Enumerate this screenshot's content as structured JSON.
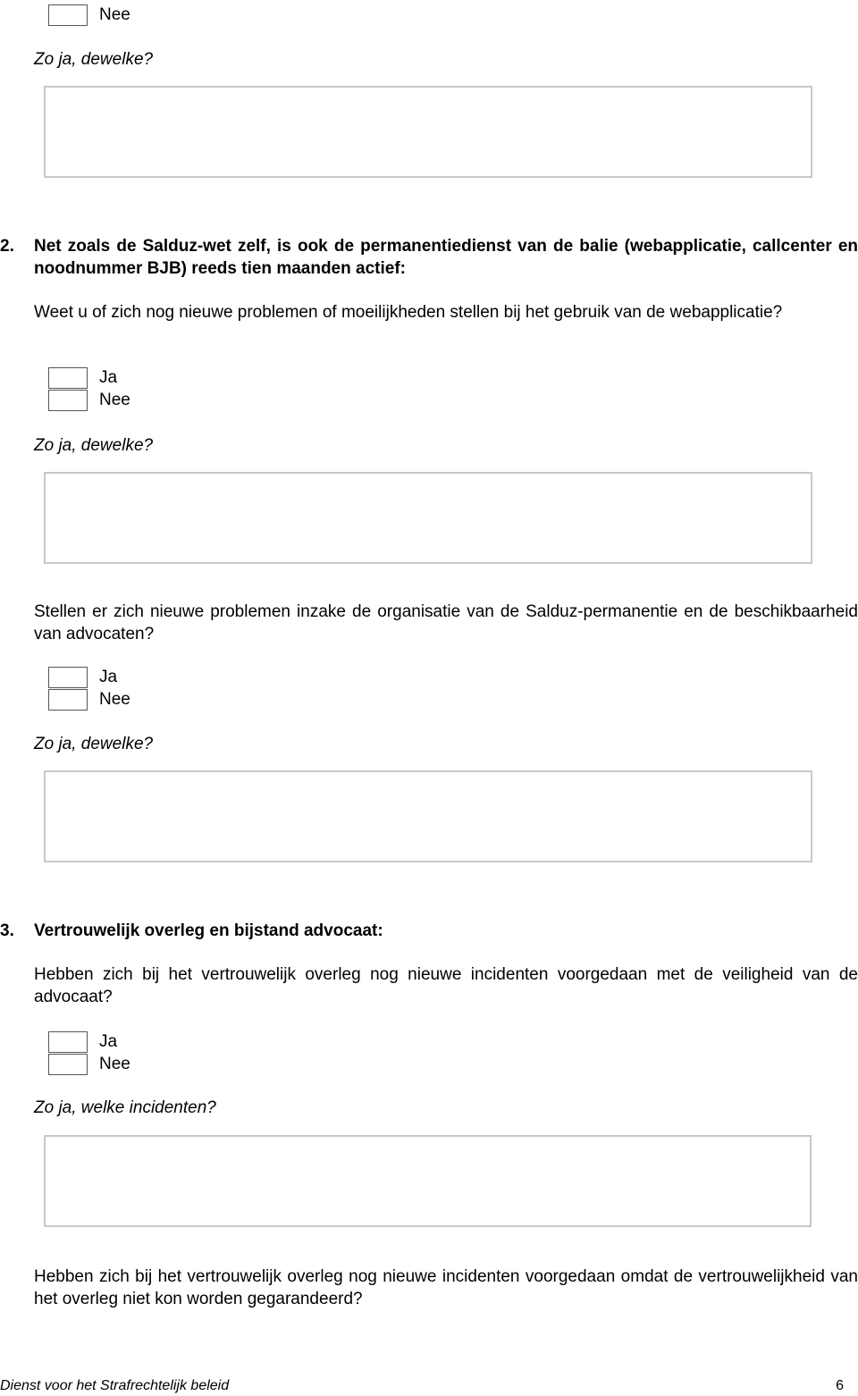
{
  "top_fragment": {
    "nee_label": "Nee",
    "followup": "Zo ja, dewelke?"
  },
  "section2": {
    "number": "2.",
    "heading": "Net zoals de Salduz-wet zelf, is ook de permanentiedienst van de balie (webapplicatie, callcenter en noodnummer BJB) reeds tien maanden actief:",
    "q1": {
      "text": "Weet u of zich nog nieuwe problemen of moeilijkheden stellen bij het gebruik van de webapplicatie?",
      "ja_label": "Ja",
      "nee_label": "Nee",
      "followup": "Zo ja, dewelke?"
    },
    "q2": {
      "text": "Stellen er zich nieuwe problemen inzake de organisatie van de Salduz-permanentie en de beschikbaarheid van advocaten?",
      "ja_label": "Ja",
      "nee_label": "Nee",
      "followup": "Zo ja, dewelke?"
    }
  },
  "section3": {
    "number": "3.",
    "heading": "Vertrouwelijk overleg en bijstand advocaat:",
    "q1": {
      "text": "Hebben zich bij het vertrouwelijk overleg nog nieuwe incidenten voorgedaan met de veiligheid van de advocaat?",
      "ja_label": "Ja",
      "nee_label": "Nee",
      "followup": "Zo ja, welke incidenten?"
    },
    "q2": {
      "text": "Hebben zich bij het vertrouwelijk overleg nog nieuwe incidenten voorgedaan omdat de vertrouwelijkheid van het overleg niet kon worden gegarandeerd?"
    }
  },
  "footer": {
    "organization": "Dienst voor het Strafrechtelijk beleid",
    "page_number": "6"
  }
}
